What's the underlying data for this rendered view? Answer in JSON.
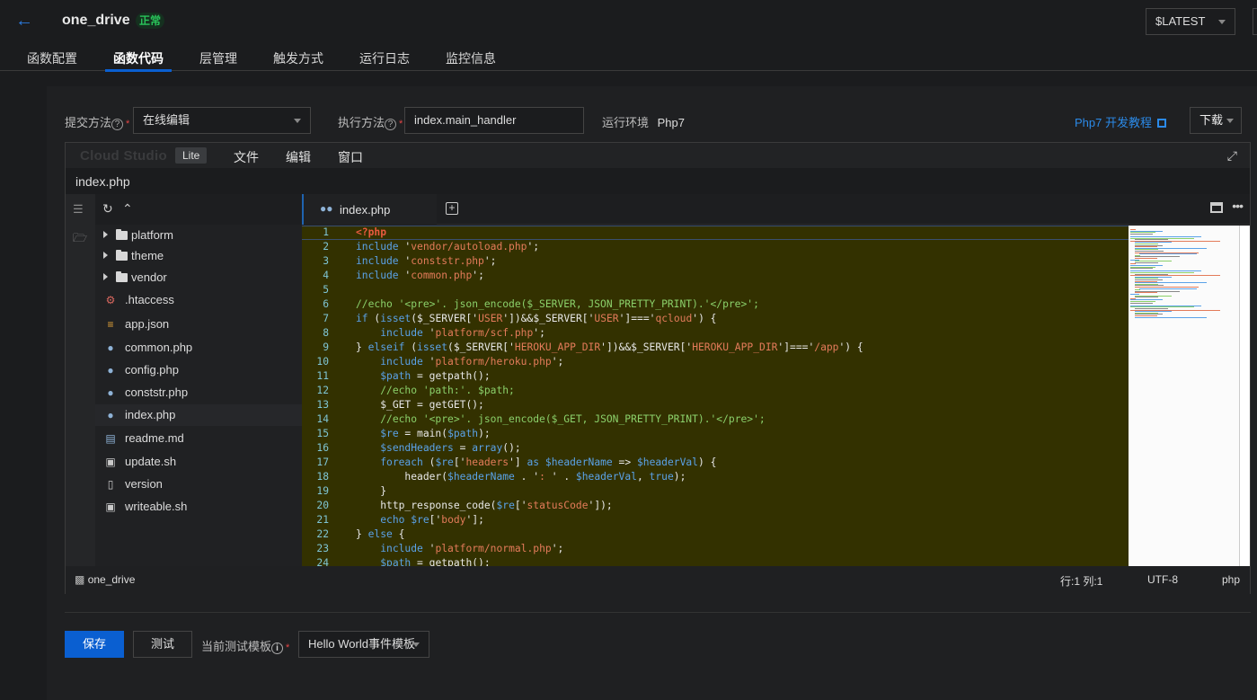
{
  "header": {
    "title": "one_drive",
    "status_badge": "正常",
    "version": "$LATEST"
  },
  "tabs": [
    "函数配置",
    "函数代码",
    "层管理",
    "触发方式",
    "运行日志",
    "监控信息"
  ],
  "active_tab": "函数代码",
  "form": {
    "submit_method_label": "提交方法",
    "submit_method_value": "在线编辑",
    "handler_label": "执行方法",
    "handler_value": "index.main_handler",
    "runtime_label": "运行环境",
    "runtime_value": "Php7",
    "tutorial_link": "Php7 开发教程",
    "download_label": "下载"
  },
  "ide": {
    "brand": "Cloud Studio",
    "brand_badge": "Lite",
    "menus": [
      "文件",
      "编辑",
      "窗口"
    ],
    "current_file": "index.php",
    "open_tab": "index.php",
    "tree": [
      {
        "name": "platform",
        "type": "folder"
      },
      {
        "name": "theme",
        "type": "folder"
      },
      {
        "name": "vendor",
        "type": "folder"
      },
      {
        "name": ".htaccess",
        "type": "config"
      },
      {
        "name": "app.json",
        "type": "json"
      },
      {
        "name": "common.php",
        "type": "php"
      },
      {
        "name": "config.php",
        "type": "php"
      },
      {
        "name": "conststr.php",
        "type": "php"
      },
      {
        "name": "index.php",
        "type": "php",
        "selected": true
      },
      {
        "name": "readme.md",
        "type": "markdown"
      },
      {
        "name": "update.sh",
        "type": "shell"
      },
      {
        "name": "version",
        "type": "file"
      },
      {
        "name": "writeable.sh",
        "type": "shell"
      }
    ],
    "code_lines": [
      "<?php",
      "include 'vendor/autoload.php';",
      "include 'conststr.php';",
      "include 'common.php';",
      "",
      "//echo '<pre>'. json_encode($_SERVER, JSON_PRETTY_PRINT).'</pre>';",
      "if (isset($_SERVER['USER'])&&$_SERVER['USER']==='qcloud') {",
      "    include 'platform/scf.php';",
      "} elseif (isset($_SERVER['HEROKU_APP_DIR'])&&$_SERVER['HEROKU_APP_DIR']==='/app') {",
      "    include 'platform/heroku.php';",
      "    $path = getpath();",
      "    //echo 'path:'. $path;",
      "    $_GET = getGET();",
      "    //echo '<pre>'. json_encode($_GET, JSON_PRETTY_PRINT).'</pre>';",
      "    $re = main($path);",
      "    $sendHeaders = array();",
      "    foreach ($re['headers'] as $headerName => $headerVal) {",
      "        header($headerName . ': ' . $headerVal, true);",
      "    }",
      "    http_response_code($re['statusCode']);",
      "    echo $re['body'];",
      "} else {",
      "    include 'platform/normal.php';",
      "    $path = getpath();"
    ],
    "status": {
      "project": "one_drive",
      "cursor": "行:1 列:1",
      "encoding": "UTF-8",
      "language": "php"
    }
  },
  "footer": {
    "save_label": "保存",
    "test_label": "测试",
    "template_label": "当前测试模板",
    "template_value": "Hello World事件模板"
  }
}
